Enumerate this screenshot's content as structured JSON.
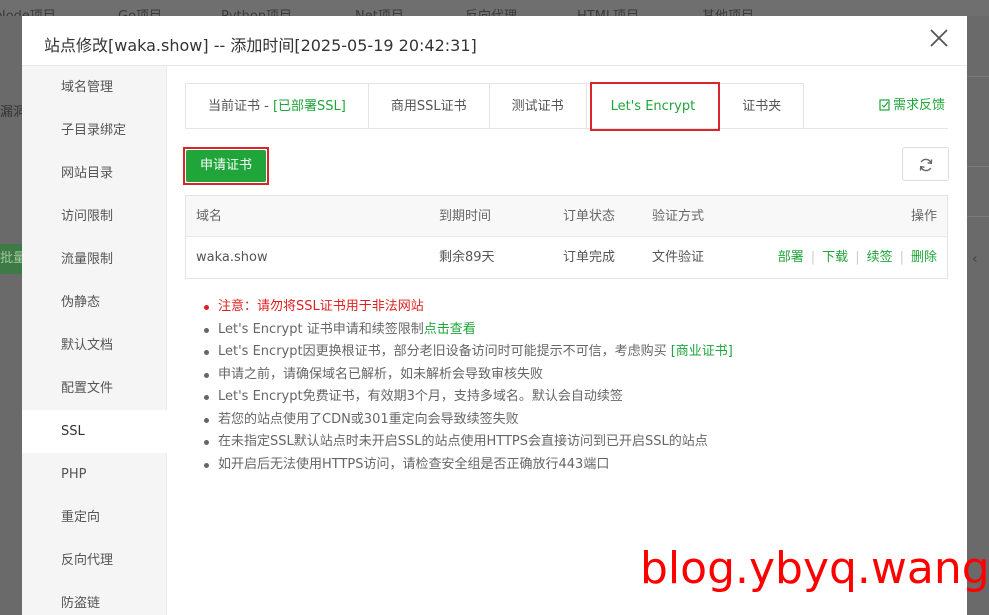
{
  "background": {
    "top_nav": [
      "Node项目",
      "Go项目",
      "Python项目",
      "Net项目",
      "反向代理",
      "HTML项目",
      "其他项目"
    ],
    "left_text": "漏洞",
    "left_green_text": "批量"
  },
  "modal": {
    "title": "站点修改[waka.show] -- 添加时间[2025-05-19 20:42:31]"
  },
  "sidebar": {
    "items": [
      {
        "label": "域名管理"
      },
      {
        "label": "子目录绑定"
      },
      {
        "label": "网站目录"
      },
      {
        "label": "访问限制"
      },
      {
        "label": "流量限制"
      },
      {
        "label": "伪静态"
      },
      {
        "label": "默认文档"
      },
      {
        "label": "配置文件"
      },
      {
        "label": "SSL"
      },
      {
        "label": "PHP"
      },
      {
        "label": "重定向"
      },
      {
        "label": "反向代理"
      },
      {
        "label": "防盗链"
      }
    ],
    "active": "SSL"
  },
  "tabs": {
    "current_cert_prefix": "当前证书 - ",
    "current_cert_status": "[已部署SSL]",
    "commercial": "商用SSL证书",
    "test": "测试证书",
    "letsencrypt": "Let's Encrypt",
    "folder": "证书夹",
    "active": "Let's Encrypt"
  },
  "feedback_label": "需求反馈",
  "apply_button": "申请证书",
  "table": {
    "headers": {
      "domain": "域名",
      "expire": "到期时间",
      "status": "订单状态",
      "verify": "验证方式",
      "ops": "操作"
    },
    "rows": [
      {
        "domain": "waka.show",
        "expire": "剩余89天",
        "status": "订单完成",
        "verify": "文件验证",
        "actions": [
          "部署",
          "下载",
          "续签",
          "删除"
        ]
      }
    ]
  },
  "notes": {
    "n1": "注意：请勿将SSL证书用于非法网站",
    "n2_text": "Let's Encrypt 证书申请和续签限制",
    "n2_link": "点击查看",
    "n3_text": "Let's Encrypt因更换根证书，部分老旧设备访问时可能提示不可信，考虑购买 ",
    "n3_link": "[商业证书]",
    "n4": "申请之前，请确保域名已解析，如未解析会导致审核失败",
    "n5": "Let's Encrypt免费证书，有效期3个月，支持多域名。默认会自动续签",
    "n6": "若您的站点使用了CDN或301重定向会导致续签失败",
    "n7": "在未指定SSL默认站点时未开启SSL的站点使用HTTPS会直接访问到已开启SSL的站点",
    "n8": "如开启后无法使用HTTPS访问，请检查安全组是否正确放行443端口"
  },
  "watermark": "blog.ybyq.wang",
  "colors": {
    "accent": "#20a53a",
    "warning": "#e02020",
    "highlight_box": "#d9262c"
  }
}
